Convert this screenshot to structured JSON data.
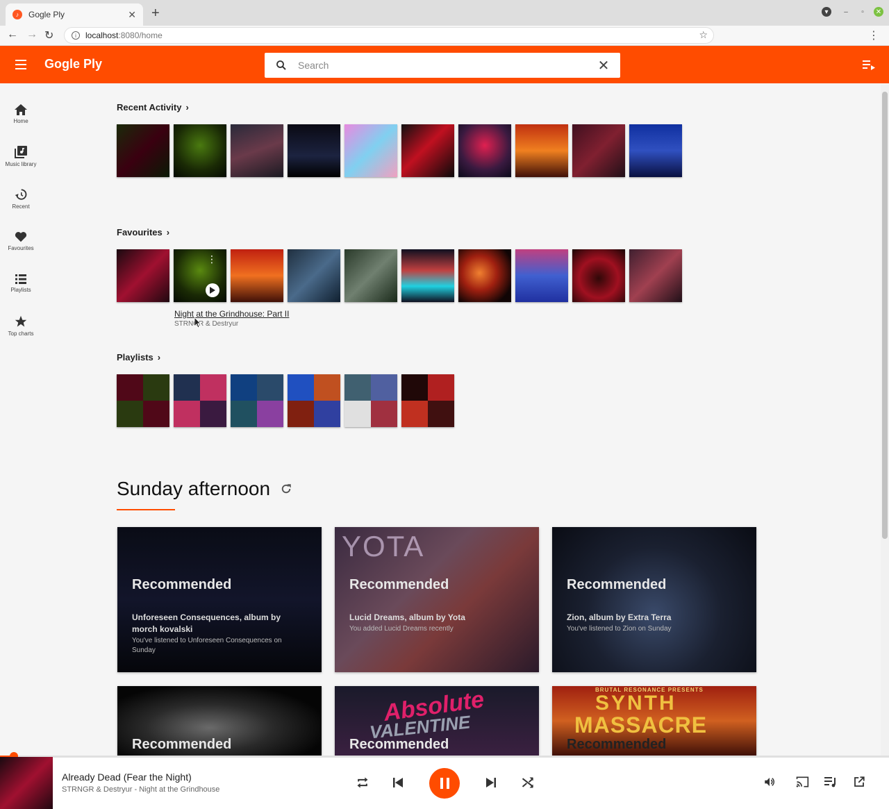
{
  "browser": {
    "tab_title": "Gogle Ply",
    "url_host": "localhost",
    "url_path": ":8080/home"
  },
  "app": {
    "logo": "Gogle Ply",
    "search_placeholder": "Search",
    "brand_color": "#ff4c00"
  },
  "sidebar": {
    "items": [
      {
        "label": "Home",
        "icon": "home-icon"
      },
      {
        "label": "Music library",
        "icon": "library-icon"
      },
      {
        "label": "Recent",
        "icon": "history-icon"
      },
      {
        "label": "Favourites",
        "icon": "heart-icon"
      },
      {
        "label": "Playlists",
        "icon": "list-icon"
      },
      {
        "label": "Top charts",
        "icon": "star-icon"
      }
    ]
  },
  "sections": {
    "recent": "Recent Activity",
    "favourites": "Favourites",
    "playlists": "Playlists"
  },
  "favourite_hover": {
    "title": "Night at the Grindhouse: Part II",
    "artist": "STRNGR & Destryur"
  },
  "mix": {
    "title": "Sunday afternoon"
  },
  "cards": [
    {
      "label": "Recommended",
      "title": "Unforeseen Consequences, album by morch kovalski",
      "sub": "You've listened to Unforeseen Consequences on Sunday"
    },
    {
      "label": "Recommended",
      "title": "Lucid Dreams, album by Yota",
      "sub": "You added Lucid Dreams recently"
    },
    {
      "label": "Recommended",
      "title": "Zion, album by Extra Terra",
      "sub": "You've listened to Zion on Sunday"
    },
    {
      "label": "Recommended",
      "title": "",
      "sub": ""
    },
    {
      "label": "Recommended",
      "title": "",
      "sub": ""
    },
    {
      "label": "Recommended",
      "title": "",
      "sub": ""
    }
  ],
  "card_art_text": {
    "yota": "YOTA",
    "absolute": "Absolute",
    "valentine": "VALENTINE",
    "synth": "SYNTH",
    "massacre": "MASSACRE",
    "brutal": "BRUTAL RESONANCE PRESENTS"
  },
  "player": {
    "track": "Already Dead (Fear the Night)",
    "subtitle": "STRNGR & Destryur - Night at the Grindhouse",
    "progress": 0.016
  }
}
